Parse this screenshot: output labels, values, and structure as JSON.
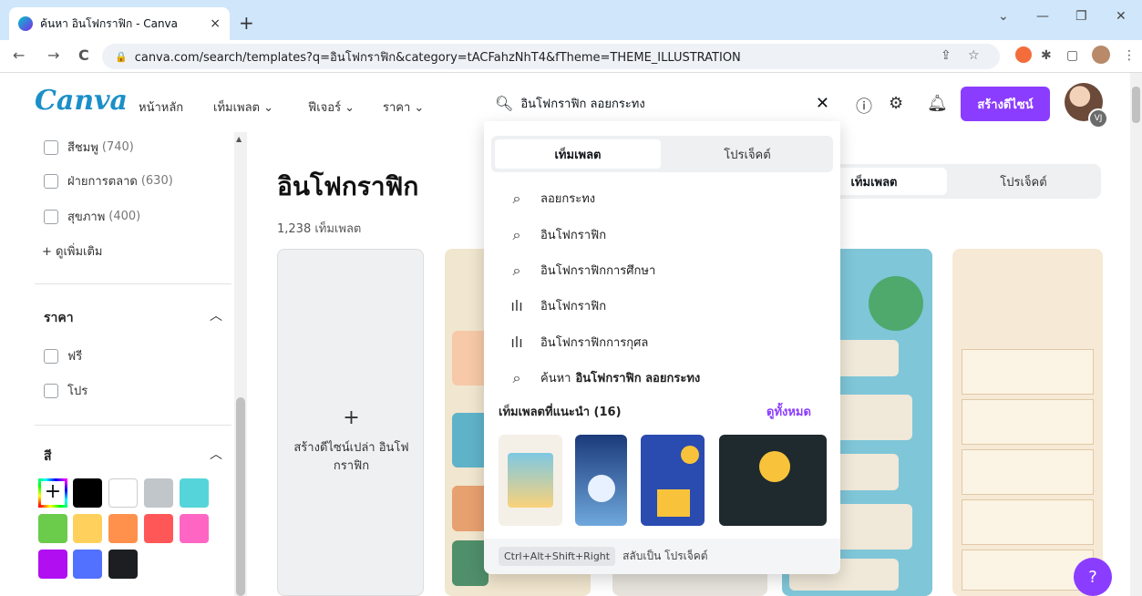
{
  "browser": {
    "tab_title": "ค้นหา อินโฟกราฟิก - Canva",
    "tab_close": "×",
    "new_tab": "+",
    "url": "canva.com/search/templates?q=อินโฟกราฟิก&category=tACFahzNhT4&fTheme=THEME_ILLUSTRATION",
    "window_controls": {
      "collapse": "⌄",
      "minimize": "—",
      "restore": "❐",
      "close": "✕"
    },
    "nav": {
      "back": "←",
      "forward": "→",
      "reload": "C"
    }
  },
  "header": {
    "logo": "Canva",
    "nav": [
      "หน้าหลัก",
      "เท็มเพลต ⌄",
      "ฟีเจอร์ ⌄",
      "ราคา ⌄"
    ],
    "create_button": "สร้างดีไซน์",
    "avatar_initials": "VJ",
    "icons": [
      "help-icon",
      "settings-icon",
      "bell-icon"
    ]
  },
  "search": {
    "query": "อินโฟกราฟิก ลอยกระทง",
    "tabs": [
      "เท็มเพลต",
      "โปรเจ็คต์"
    ],
    "suggestions": [
      {
        "icon": "search-icon",
        "text": "ลอยกระทง"
      },
      {
        "icon": "search-icon",
        "text": "อินโฟกราฟิก"
      },
      {
        "icon": "search-icon",
        "text": "อินโฟกราฟิกการศึกษา"
      },
      {
        "icon": "trend-icon",
        "text": "อินโฟกราฟิก"
      },
      {
        "icon": "trend-icon",
        "text": "อินโฟกราฟิกการกุศล"
      }
    ],
    "search_all_prefix": "ค้นหา",
    "search_all_query": "อินโฟกราฟิก ลอยกระทง",
    "recommended_title": "เท็มเพลตที่แนะนำ (16)",
    "see_all": "ดูทั้งหมด",
    "shortcut_key": "Ctrl+Alt+Shift+Right",
    "shortcut_label": "สลับเป็น โปรเจ็คต์"
  },
  "sidebar": {
    "top_filters": [
      {
        "label": "สีชมพู",
        "count": "(740)"
      },
      {
        "label": "ฝ่ายการตลาด",
        "count": "(630)"
      },
      {
        "label": "สุขภาพ",
        "count": "(400)"
      }
    ],
    "see_more": "+ ดูเพิ่มเติม",
    "price_title": "ราคา",
    "price_options": [
      "ฟรี",
      "โปร"
    ],
    "color_title": "สี",
    "colors": [
      "#000000",
      "#ffffff",
      "#c1c6cb",
      "#55d5d9",
      "#6bcb4b",
      "#ffd15c",
      "#ff914d",
      "#ff5757",
      "#ff66c4",
      "#b10ff2",
      "#5271ff",
      "#1c1e21"
    ]
  },
  "main": {
    "title": "อินโฟกราฟิก",
    "count": "1,238 เท็มเพลต",
    "tabs": [
      "เท็มเพลต",
      "โปรเจ็คต์"
    ],
    "blank_plus": "+",
    "blank_label": "สร้างดีไซน์เปล่า อินโฟกราฟิก"
  },
  "help_button": "?"
}
